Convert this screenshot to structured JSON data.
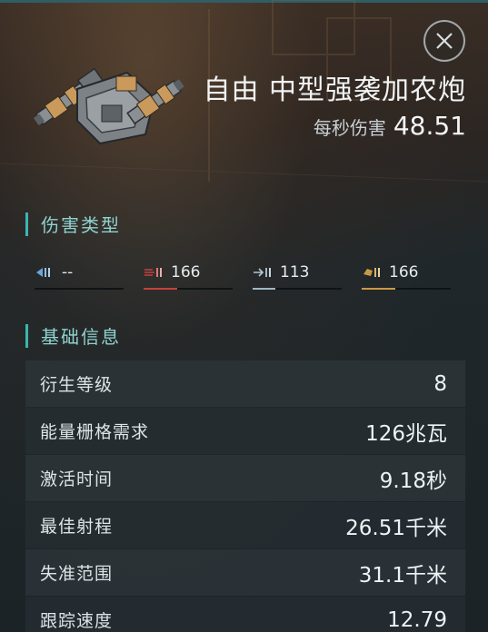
{
  "header": {
    "item_name": "自由 中型强袭加农炮",
    "dps_label": "每秒伤害",
    "dps_value": "48.51",
    "close_icon": "close-x-icon",
    "turret_icon": "medium-assault-cannon-turret"
  },
  "damage_section": {
    "title": "伤害类型",
    "types": [
      {
        "icon": "em-damage-icon",
        "value": "--",
        "fraction": 0,
        "color": "#6aa6d8"
      },
      {
        "icon": "thermal-damage-icon",
        "value": "166",
        "fraction": 0.38,
        "color": "#c5423c"
      },
      {
        "icon": "kinetic-damage-icon",
        "value": "113",
        "fraction": 0.26,
        "color": "#9fb7c4"
      },
      {
        "icon": "explosive-damage-icon",
        "value": "166",
        "fraction": 0.38,
        "color": "#c89a45"
      }
    ]
  },
  "base_info": {
    "title": "基础信息",
    "rows": [
      {
        "label": "衍生等级",
        "value": "8"
      },
      {
        "label": "能量栅格需求",
        "value": "126兆瓦"
      },
      {
        "label": "激活时间",
        "value": "9.18秒"
      },
      {
        "label": "最佳射程",
        "value": "26.51千米"
      },
      {
        "label": "失准范围",
        "value": "31.1千米"
      },
      {
        "label": "跟踪速度",
        "value": "12.79"
      }
    ]
  },
  "colors": {
    "accent": "#3bb6b1",
    "section_title": "#8fd3d0"
  }
}
